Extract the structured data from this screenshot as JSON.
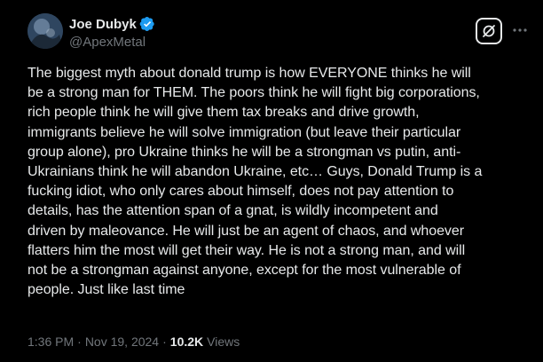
{
  "author": {
    "display_name": "Joe Dubyk",
    "handle": "@ApexMetal",
    "verified": true,
    "verified_color": "#1d9bf0"
  },
  "actions": {
    "grok_icon": "grok-slash-icon",
    "more_icon": "more-horizontal-icon"
  },
  "post": {
    "text": "The biggest myth about donald trump is how EVERYONE thinks he will\nbe a strong man for THEM. The poors think he will fight big corporations,\nrich people think he will give them tax breaks and drive growth,\nimmigrants believe he will solve immigration (but leave their particular\ngroup alone), pro Ukraine thinks he will be a strongman vs putin, anti-\nUkrainians think he will abandon Ukraine, etc… Guys, Donald Trump is a\nfucking idiot, who only cares about himself, does not pay attention to\ndetails, has the attention span of a gnat, is wildly incompetent and\ndriven by maleovance.  He will just be an agent of chaos, and whoever\nflatters him the most will get their way. He is not a strong man, and will\nnot be a strongman against anyone, except for the most vulnerable of\npeople. Just like last time"
  },
  "meta": {
    "time": "1:36 PM",
    "separator": "·",
    "date": "Nov 19, 2024",
    "views_count": "10.2K",
    "views_label": "Views"
  },
  "colors": {
    "background": "#000000",
    "text_primary": "#e7e9ea",
    "text_secondary": "#71767b"
  }
}
